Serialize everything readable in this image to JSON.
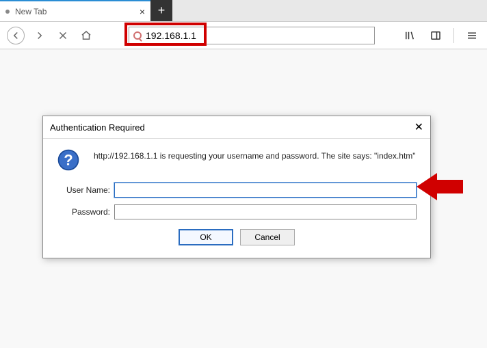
{
  "tab": {
    "title": "New Tab"
  },
  "address": {
    "value": "192.168.1.1"
  },
  "dialog": {
    "title": "Authentication Required",
    "message": "http://192.168.1.1 is requesting your username and password. The site says: \"index.htm\"",
    "username_label": "User Name:",
    "password_label": "Password:",
    "username_value": "",
    "password_value": "",
    "ok_label": "OK",
    "cancel_label": "Cancel"
  }
}
